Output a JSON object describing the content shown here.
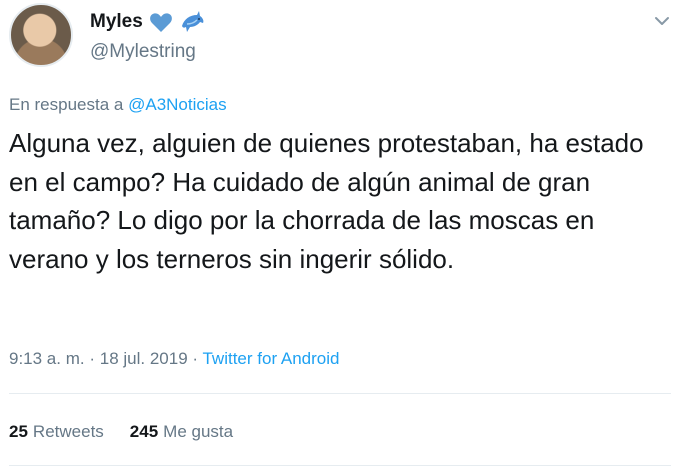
{
  "user": {
    "display_name": "Myles",
    "handle": "@Mylestring"
  },
  "reply": {
    "prefix": "En respuesta a",
    "mention": "@A3Noticias"
  },
  "tweet": {
    "text": "Alguna vez, alguien de quienes protestaban, ha estado en el campo? Ha cuidado de algún animal de gran tamaño? Lo digo por la chorrada de las moscas en verano y los terneros sin ingerir sólido."
  },
  "meta": {
    "time": "9:13 a. m.",
    "separator": "·",
    "date": "18 jul. 2019",
    "source": "Twitter for Android"
  },
  "stats": {
    "retweets_count": "25",
    "retweets_label": "Retweets",
    "likes_count": "245",
    "likes_label": "Me gusta"
  },
  "colors": {
    "accent": "#1da1f2",
    "secondary_text": "#657786",
    "divider": "#e6ecf0",
    "heart": "#5b9bd5"
  },
  "icons": [
    "blue-heart-icon",
    "dolphin-icon",
    "chevron-down-icon"
  ]
}
